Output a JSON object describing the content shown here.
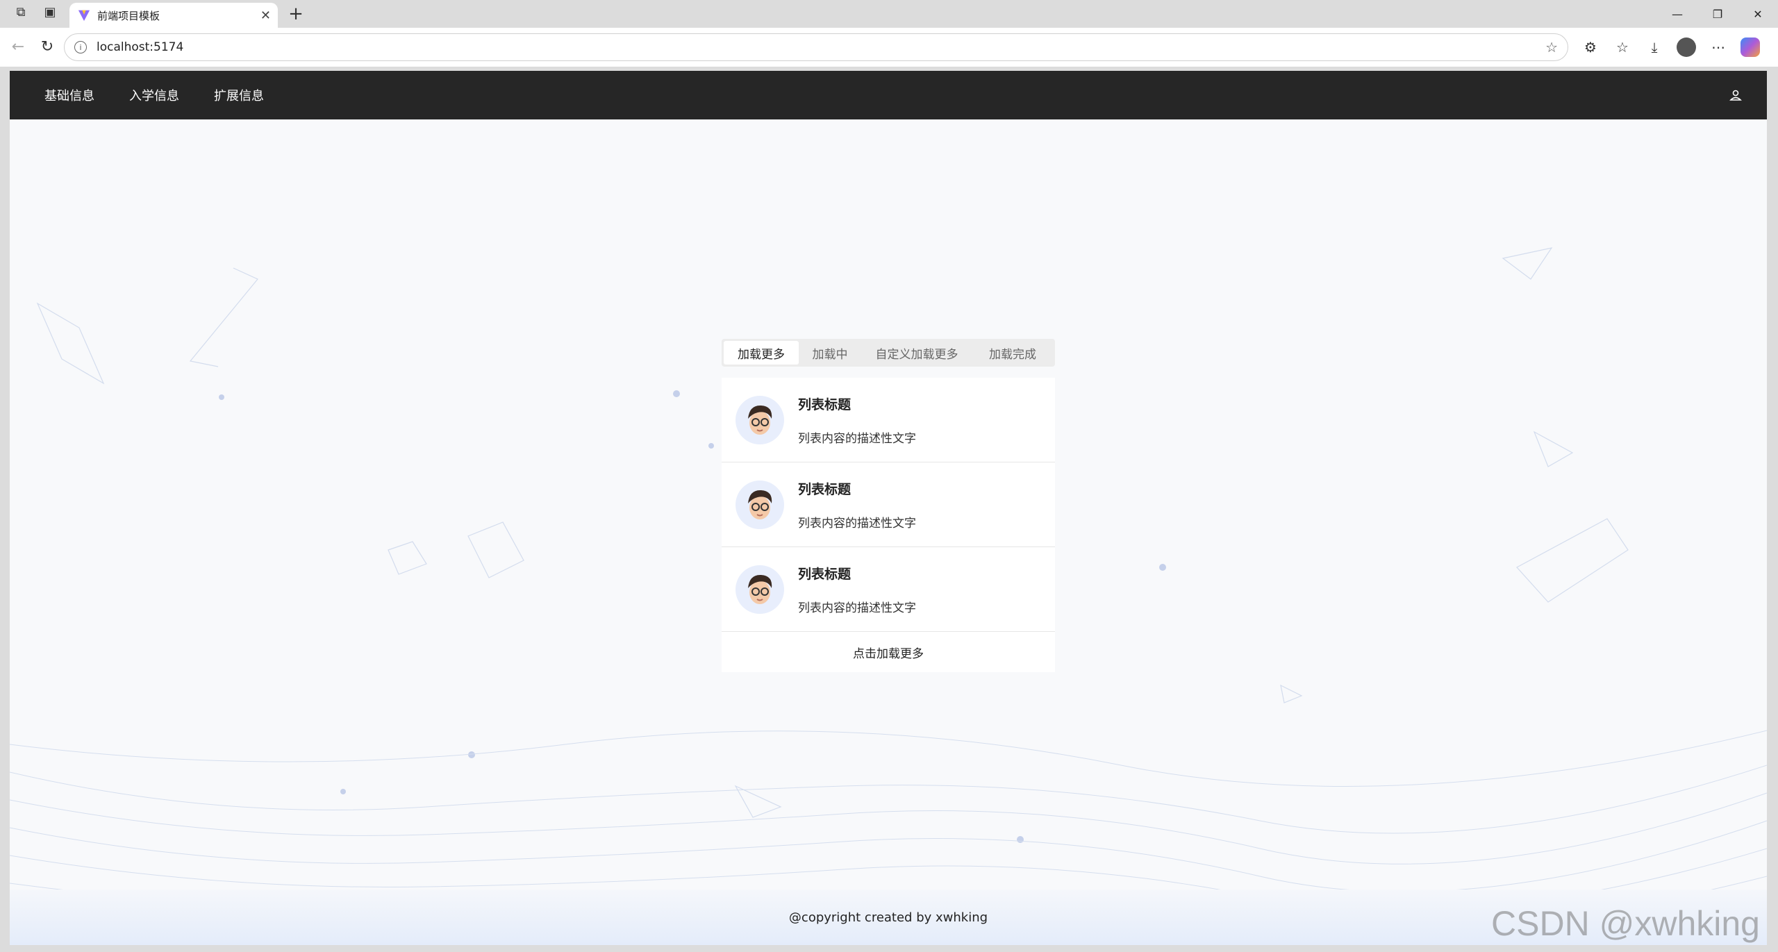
{
  "browser": {
    "tab_title": "前端项目模板",
    "url": "localhost:5174"
  },
  "navbar": {
    "menu": [
      {
        "label": "基础信息"
      },
      {
        "label": "入学信息"
      },
      {
        "label": "扩展信息"
      }
    ]
  },
  "widget": {
    "tabs": [
      {
        "label": "加载更多"
      },
      {
        "label": "加载中"
      },
      {
        "label": "自定义加载更多"
      },
      {
        "label": "加载完成"
      }
    ],
    "list": [
      {
        "title": "列表标题",
        "description": "列表内容的描述性文字"
      },
      {
        "title": "列表标题",
        "description": "列表内容的描述性文字"
      },
      {
        "title": "列表标题",
        "description": "列表内容的描述性文字"
      }
    ],
    "load_more_label": "点击加载更多"
  },
  "footer": {
    "text": "@copyright created by xwhking"
  },
  "watermark": "CSDN @xwhking",
  "colors": {
    "navbar_bg": "#262626",
    "page_bg": "#f8f9fb"
  }
}
